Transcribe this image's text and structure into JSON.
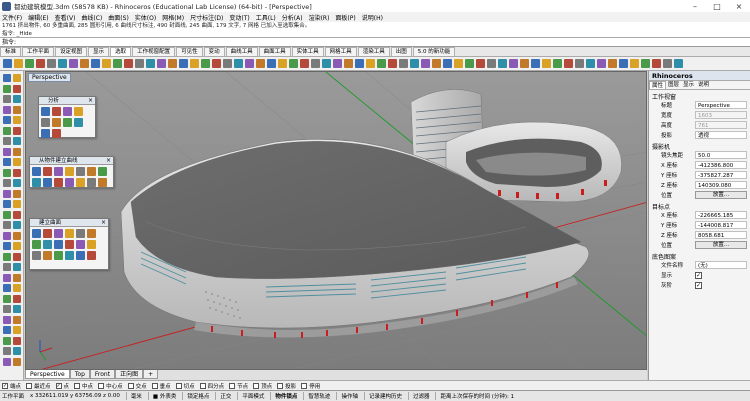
{
  "window": {
    "title": "都幼建筑模型.3dm (58578 KB) - Rhinoceros (Educational Lab License) (64-bit) - [Perspective]",
    "minimize": "–",
    "maximize": "□",
    "close": "×"
  },
  "menu": [
    "文件(F)",
    "编辑(E)",
    "查看(V)",
    "曲线(C)",
    "曲面(S)",
    "实体(O)",
    "网格(M)",
    "尺寸标注(D)",
    "变动(T)",
    "工具(L)",
    "分析(A)",
    "渲染(R)",
    "面板(P)",
    "说明(H)"
  ],
  "command_history": [
    "1761 挤出物件, 60 多重曲面, 285 圆形引用, 6 曲线尺寸标注, 490 封面线, 245 曲面, 179 文字, 7 网格 已加入至选取集合。",
    "指令: _Hide"
  ],
  "command_prompt": "指令:",
  "toolbar_tabs": [
    "标准",
    "工作平面",
    "设定视图",
    "显示",
    "选取",
    "工作视窗配置",
    "可见性",
    "变动",
    "曲线工具",
    "曲面工具",
    "实体工具",
    "网格工具",
    "渲染工具",
    "出图",
    "5.0 的新功能"
  ],
  "toolbar_active_tab": "选取",
  "viewport": {
    "label": "Perspective"
  },
  "panels": {
    "analysis": {
      "title": "分析"
    },
    "from_object": {
      "title": "从物件建立曲线"
    },
    "create_surface": {
      "title": "建立曲面"
    }
  },
  "view_tabs": [
    "Perspective",
    "Top",
    "Front",
    "正向图",
    "+"
  ],
  "view_tabs_active": "Perspective",
  "osnaps": [
    {
      "label": "端点",
      "checked": true
    },
    {
      "label": "最近点",
      "checked": false
    },
    {
      "label": "点",
      "checked": true
    },
    {
      "label": "中点",
      "checked": false
    },
    {
      "label": "中心点",
      "checked": false
    },
    {
      "label": "交点",
      "checked": false
    },
    {
      "label": "垂点",
      "checked": false
    },
    {
      "label": "切点",
      "checked": false
    },
    {
      "label": "四分点",
      "checked": false
    },
    {
      "label": "节点",
      "checked": false
    },
    {
      "label": "顶点",
      "checked": false
    },
    {
      "label": "投影",
      "checked": false
    },
    {
      "label": "停用",
      "checked": false
    }
  ],
  "status": {
    "plane": "工作平面",
    "coords": "x 332611.019  y 63756.09   z 0.00",
    "unit": "毫米",
    "layer": "■ 外表类",
    "toggles": [
      "锁定格点",
      "正交",
      "平面模式",
      "物件锁点",
      "智慧轨迹",
      "操作轴",
      "记录建构历史",
      "过滤器"
    ],
    "message": "距离上次保存的时间 (分钟): 1"
  },
  "properties": {
    "title": "Rhinoceros",
    "tabs": [
      "属性",
      "图层",
      "显示",
      "说明"
    ],
    "active_tab": "属性",
    "section_viewport": "工作视窗",
    "title_label": "标题",
    "title_value": "Perspective",
    "width_label": "宽度",
    "width_value": "1603",
    "height_label": "高度",
    "height_value": "761",
    "projection_label": "投影",
    "projection_value": "透视",
    "section_camera": "摄影机",
    "lens_label": "镜头焦距",
    "lens_value": "50.0",
    "cx_label": "X 座标",
    "cx_value": "-412386.800",
    "cy_label": "Y 座标",
    "cy_value": "-375827.287",
    "cz_label": "Z 座标",
    "cz_value": "140309.080",
    "cam_pos_label": "位置",
    "cam_pos_btn": "放置...",
    "section_target": "目标点",
    "tx_label": "X 座标",
    "tx_value": "-226665.185",
    "ty_label": "Y 座标",
    "ty_value": "-144008.817",
    "tz_label": "Z 座标",
    "tz_value": "8058.681",
    "tgt_pos_label": "位置",
    "tgt_pos_btn": "放置...",
    "section_wallpaper": "底色图案",
    "file_label": "文件名称",
    "file_value": "(无)",
    "show_label": "显示",
    "show_check": "✓",
    "gray_label": "灰阶",
    "gray_check": "✓"
  },
  "colors": {
    "viewport_bg": "#8e8e8e",
    "grid_red": "#c81e1e",
    "grid_green": "#1e9a2a",
    "accent_panel": "#dde4ee"
  }
}
